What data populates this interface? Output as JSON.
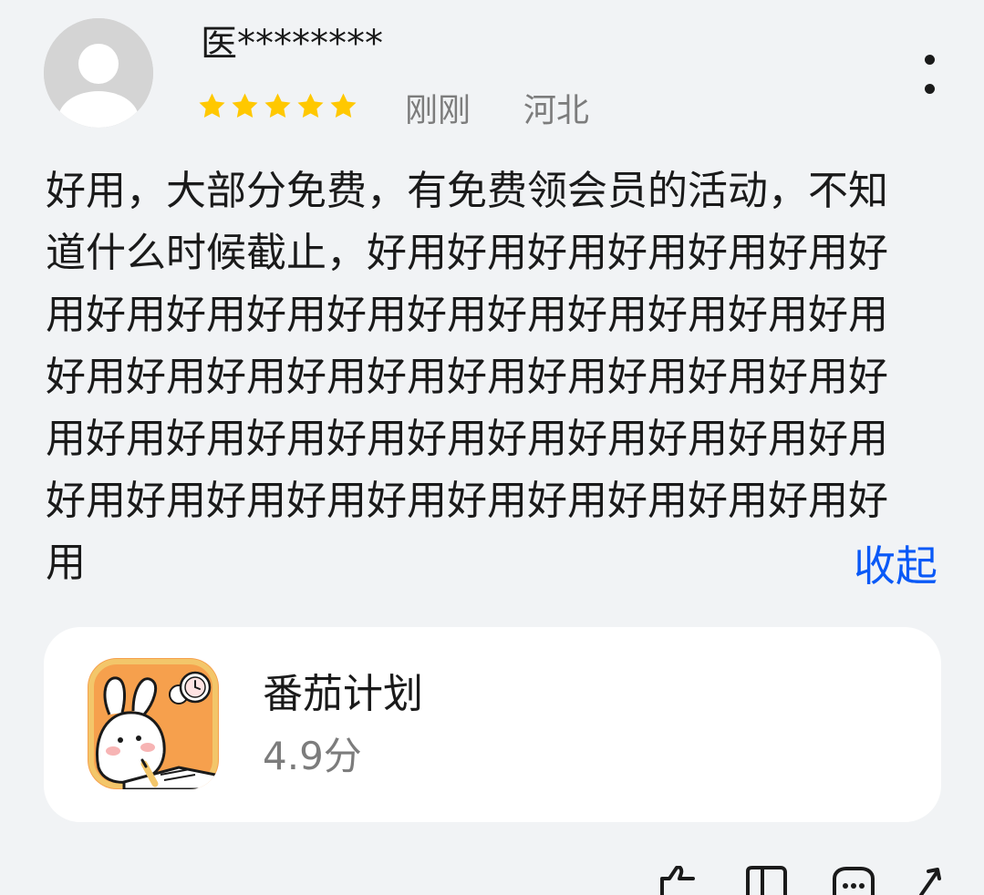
{
  "review": {
    "username": "医********",
    "rating_stars": 5,
    "time": "刚刚",
    "location": "河北",
    "body": "好用，大部分免费，有免费领会员的活动，不知道什么时候截止，好用好用好用好用好用好用好用好用好用好用好用好用好用好用好用好用好用好用好用好用好用好用好用好用好用好用好用好用好用好用好用好用好用好用好用好用好用好用好用好用好用好用好用好用好用好用好用好用好用",
    "collapse_label": "收起"
  },
  "app": {
    "name": "番茄计划",
    "rating": "4.9分"
  },
  "icons": {
    "avatar": "default-user-avatar",
    "more": "more-vertical-icon",
    "star": "star-icon",
    "actions": [
      "thumbs-up-icon",
      "bookmark-icon",
      "comment-icon",
      "share-icon"
    ]
  },
  "colors": {
    "background": "#f1f3f5",
    "star": "#ffc800",
    "link": "#0a59f7",
    "secondary_text": "#7c7c7c",
    "card": "#ffffff"
  }
}
